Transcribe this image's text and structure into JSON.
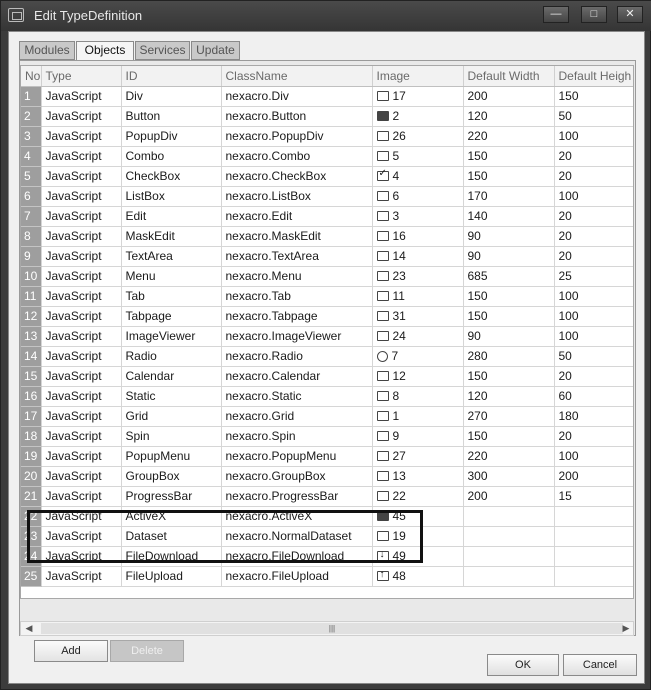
{
  "window": {
    "title": "Edit TypeDefinition",
    "min_label": "—",
    "max_label": "□",
    "close_label": "✕"
  },
  "tabs": [
    {
      "label": "Modules",
      "active": false
    },
    {
      "label": "Objects",
      "active": true
    },
    {
      "label": "Services",
      "active": false
    },
    {
      "label": "Update",
      "active": false
    }
  ],
  "grid": {
    "headers": [
      "No",
      "Type",
      "ID",
      "ClassName",
      "Image",
      "Default Width",
      "Default Heigh"
    ],
    "rows": [
      {
        "no": "1",
        "type": "JavaScript",
        "id": "Div",
        "class": "nexacro.Div",
        "icon": "div-icon",
        "image": "17",
        "w": "200",
        "h": "150"
      },
      {
        "no": "2",
        "type": "JavaScript",
        "id": "Button",
        "class": "nexacro.Button",
        "icon": "button-icon",
        "image": "2",
        "w": "120",
        "h": "50"
      },
      {
        "no": "3",
        "type": "JavaScript",
        "id": "PopupDiv",
        "class": "nexacro.PopupDiv",
        "icon": "popupdiv-icon",
        "image": "26",
        "w": "220",
        "h": "100"
      },
      {
        "no": "4",
        "type": "JavaScript",
        "id": "Combo",
        "class": "nexacro.Combo",
        "icon": "combo-icon",
        "image": "5",
        "w": "150",
        "h": "20"
      },
      {
        "no": "5",
        "type": "JavaScript",
        "id": "CheckBox",
        "class": "nexacro.CheckBox",
        "icon": "checkbox-icon",
        "image": "4",
        "w": "150",
        "h": "20"
      },
      {
        "no": "6",
        "type": "JavaScript",
        "id": "ListBox",
        "class": "nexacro.ListBox",
        "icon": "listbox-icon",
        "image": "6",
        "w": "170",
        "h": "100"
      },
      {
        "no": "7",
        "type": "JavaScript",
        "id": "Edit",
        "class": "nexacro.Edit",
        "icon": "edit-icon",
        "image": "3",
        "w": "140",
        "h": "20"
      },
      {
        "no": "8",
        "type": "JavaScript",
        "id": "MaskEdit",
        "class": "nexacro.MaskEdit",
        "icon": "maskedit-icon",
        "image": "16",
        "w": "90",
        "h": "20"
      },
      {
        "no": "9",
        "type": "JavaScript",
        "id": "TextArea",
        "class": "nexacro.TextArea",
        "icon": "textarea-icon",
        "image": "14",
        "w": "90",
        "h": "20"
      },
      {
        "no": "10",
        "type": "JavaScript",
        "id": "Menu",
        "class": "nexacro.Menu",
        "icon": "menu-icon",
        "image": "23",
        "w": "685",
        "h": "25"
      },
      {
        "no": "11",
        "type": "JavaScript",
        "id": "Tab",
        "class": "nexacro.Tab",
        "icon": "tab-icon",
        "image": "11",
        "w": "150",
        "h": "100"
      },
      {
        "no": "12",
        "type": "JavaScript",
        "id": "Tabpage",
        "class": "nexacro.Tabpage",
        "icon": "tabpage-icon",
        "image": "31",
        "w": "150",
        "h": "100"
      },
      {
        "no": "13",
        "type": "JavaScript",
        "id": "ImageViewer",
        "class": "nexacro.ImageViewer",
        "icon": "imageviewer-icon",
        "image": "24",
        "w": "90",
        "h": "100"
      },
      {
        "no": "14",
        "type": "JavaScript",
        "id": "Radio",
        "class": "nexacro.Radio",
        "icon": "radio-icon",
        "image": "7",
        "w": "280",
        "h": "50"
      },
      {
        "no": "15",
        "type": "JavaScript",
        "id": "Calendar",
        "class": "nexacro.Calendar",
        "icon": "calendar-icon",
        "image": "12",
        "w": "150",
        "h": "20"
      },
      {
        "no": "16",
        "type": "JavaScript",
        "id": "Static",
        "class": "nexacro.Static",
        "icon": "static-icon",
        "image": "8",
        "w": "120",
        "h": "60"
      },
      {
        "no": "17",
        "type": "JavaScript",
        "id": "Grid",
        "class": "nexacro.Grid",
        "icon": "grid-icon",
        "image": "1",
        "w": "270",
        "h": "180"
      },
      {
        "no": "18",
        "type": "JavaScript",
        "id": "Spin",
        "class": "nexacro.Spin",
        "icon": "spin-icon",
        "image": "9",
        "w": "150",
        "h": "20"
      },
      {
        "no": "19",
        "type": "JavaScript",
        "id": "PopupMenu",
        "class": "nexacro.PopupMenu",
        "icon": "popupmenu-icon",
        "image": "27",
        "w": "220",
        "h": "100"
      },
      {
        "no": "20",
        "type": "JavaScript",
        "id": "GroupBox",
        "class": "nexacro.GroupBox",
        "icon": "groupbox-icon",
        "image": "13",
        "w": "300",
        "h": "200"
      },
      {
        "no": "21",
        "type": "JavaScript",
        "id": "ProgressBar",
        "class": "nexacro.ProgressBar",
        "icon": "progressbar-icon",
        "image": "22",
        "w": "200",
        "h": "15"
      },
      {
        "no": "22",
        "type": "JavaScript",
        "id": "ActiveX",
        "class": "nexacro.ActiveX",
        "icon": "activex-icon",
        "image": "45",
        "w": "",
        "h": ""
      },
      {
        "no": "23",
        "type": "JavaScript",
        "id": "Dataset",
        "class": "nexacro.NormalDataset",
        "icon": "dataset-icon",
        "image": "19",
        "w": "",
        "h": ""
      },
      {
        "no": "24",
        "type": "JavaScript",
        "id": "FileDownload",
        "class": "nexacro.FileDownload",
        "icon": "filedownload-icon",
        "image": "49",
        "w": "",
        "h": ""
      },
      {
        "no": "25",
        "type": "JavaScript",
        "id": "FileUpload",
        "class": "nexacro.FileUpload",
        "icon": "fileupload-icon",
        "image": "48",
        "w": "",
        "h": ""
      }
    ]
  },
  "scrollbar": {
    "left": "◀",
    "right": "▶",
    "grip": "|||"
  },
  "buttons": {
    "add": "Add",
    "delete": "Delete",
    "ok": "OK",
    "cancel": "Cancel"
  }
}
